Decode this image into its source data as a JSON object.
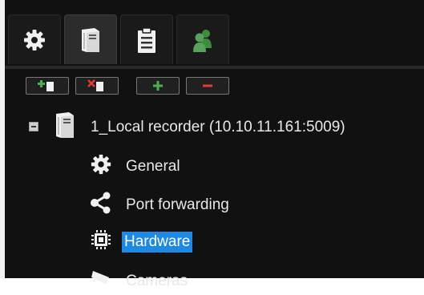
{
  "tabs": [
    {
      "name": "settings-tab",
      "icon": "gear-icon"
    },
    {
      "name": "recorder-tab",
      "icon": "server-tower-icon",
      "active": true
    },
    {
      "name": "clipboard-tab",
      "icon": "clipboard-icon"
    },
    {
      "name": "users-tab",
      "icon": "users-icon"
    }
  ],
  "toolbar": [
    {
      "name": "add-recorder-button",
      "icon": "add-server-icon"
    },
    {
      "name": "remove-recorder-button",
      "icon": "remove-server-icon"
    },
    {
      "name": "add-button",
      "icon": "plus-icon"
    },
    {
      "name": "remove-button",
      "icon": "minus-icon"
    }
  ],
  "tree": {
    "root_label": "1_Local recorder (10.10.11.161:5009)",
    "root_expanded": true,
    "children": [
      {
        "label": "General",
        "icon": "gear-icon"
      },
      {
        "label": "Port forwarding",
        "icon": "share-icon"
      },
      {
        "label": "Hardware",
        "icon": "chip-icon",
        "selected": true
      },
      {
        "label": "Cameras",
        "icon": "camera-icon"
      }
    ]
  },
  "colors": {
    "panel_bg": "#111111",
    "selection": "#1e88e5",
    "green_icon": "#4caf50",
    "red_icon": "#e53935"
  }
}
